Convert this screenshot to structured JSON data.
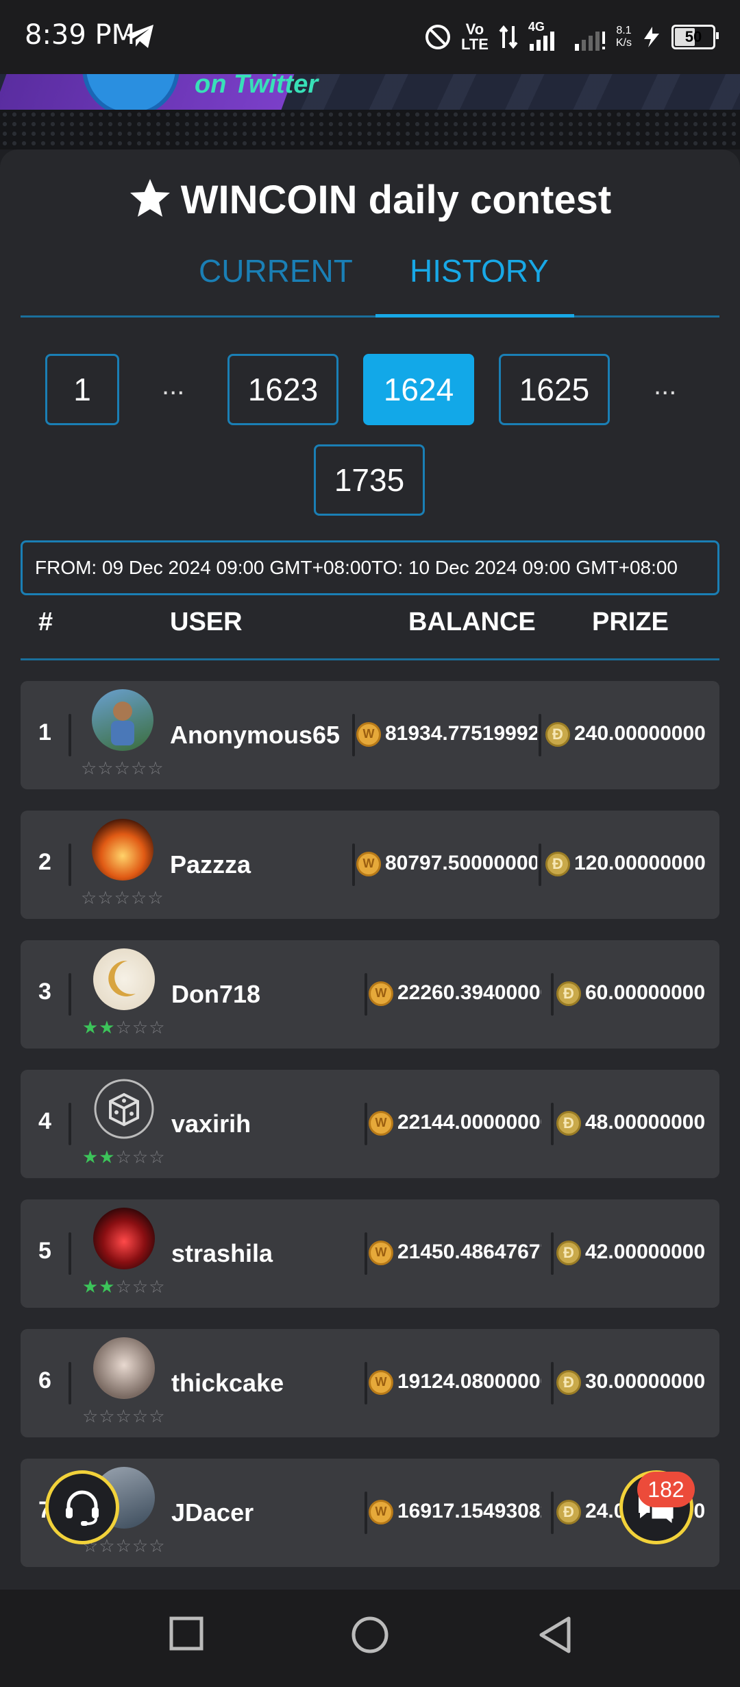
{
  "status_bar": {
    "time": "8:39 PM",
    "network_top": "Vo",
    "network_bottom": "LTE",
    "signal_type": "4G",
    "speed_top": "8.1",
    "speed_bottom": "K/s",
    "battery": "50"
  },
  "banner": {
    "text": "on Twitter"
  },
  "contest": {
    "title": "WINCOIN daily contest",
    "tabs": [
      {
        "label": "CURRENT",
        "active": false
      },
      {
        "label": "HISTORY",
        "active": true
      }
    ]
  },
  "pagination": {
    "first": "1",
    "ellipsis": "...",
    "prev": "1623",
    "current": "1624",
    "next": "1625",
    "last": "1735"
  },
  "range": {
    "from": "FROM: 09 Dec 2024 09:00 GMT+08:00",
    "to": "TO: 10 Dec 2024 09:00 GMT+08:00"
  },
  "table": {
    "headers": {
      "rank": "#",
      "user": "USER",
      "balance": "BALANCE",
      "prize": "PRIZE"
    },
    "rows": [
      {
        "rank": "1",
        "user": "Anonymous65",
        "balance": "81934.77519992",
        "prize": "240.00000000",
        "stars": 0
      },
      {
        "rank": "2",
        "user": "Pazzza",
        "balance": "80797.50000000",
        "prize": "120.00000000",
        "stars": 0
      },
      {
        "rank": "3",
        "user": "Don718",
        "balance": "22260.39400000",
        "prize": "60.00000000",
        "stars": 2
      },
      {
        "rank": "4",
        "user": "vaxirih",
        "balance": "22144.00000000",
        "prize": "48.00000000",
        "stars": 2
      },
      {
        "rank": "5",
        "user": "strashila",
        "balance": "21450.48647677",
        "prize": "42.00000000",
        "stars": 2
      },
      {
        "rank": "6",
        "user": "thickcake",
        "balance": "19124.08000000",
        "prize": "30.00000000",
        "stars": 0
      },
      {
        "rank": "7",
        "user": "JDacer",
        "balance": "16917.15493082",
        "prize": "24.00000000",
        "stars": 0
      }
    ]
  },
  "chat": {
    "badge": "182"
  },
  "colors": {
    "accent": "#12a8e8",
    "star_on": "#3cc45a",
    "fab_border": "#f2d23a",
    "badge": "#ec4b3a"
  }
}
